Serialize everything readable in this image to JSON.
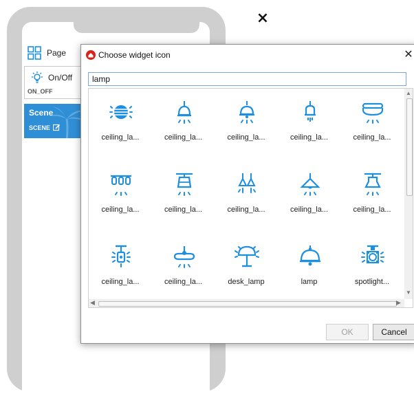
{
  "phone": {
    "close_glyph": "×",
    "page_item": {
      "label": "Page",
      "icon": "grid-icon"
    },
    "onoff_widget": {
      "label": "On/Off",
      "type": "ON_OFF",
      "icon": "bulb-icon"
    },
    "scene_widget": {
      "label": "Scene",
      "type": "SCENE",
      "icon": "edit-icon"
    }
  },
  "dialog": {
    "title": "Choose widget icon",
    "close_glyph": "✕",
    "search_value": "lamp",
    "icons": [
      {
        "label": "ceiling_la...",
        "icon": "ceiling-lamp-globe-icon"
      },
      {
        "label": "ceiling_la...",
        "icon": "ceiling-lamp-bell-icon"
      },
      {
        "label": "ceiling_la...",
        "icon": "ceiling-lamp-dome-icon"
      },
      {
        "label": "ceiling_la...",
        "icon": "ceiling-lamp-spot-icon"
      },
      {
        "label": "ceiling_la...",
        "icon": "ceiling-lamp-flush-icon"
      },
      {
        "label": "ceiling_la...",
        "icon": "ceiling-lamp-triple-icon"
      },
      {
        "label": "ceiling_la...",
        "icon": "ceiling-lamp-shade-icon"
      },
      {
        "label": "ceiling_la...",
        "icon": "ceiling-lamp-double-icon"
      },
      {
        "label": "ceiling_la...",
        "icon": "ceiling-lamp-pendant-icon"
      },
      {
        "label": "ceiling_la...",
        "icon": "ceiling-lamp-drum-icon"
      },
      {
        "label": "ceiling_la...",
        "icon": "ceiling-lamp-rod-icon"
      },
      {
        "label": "ceiling_la...",
        "icon": "ceiling-lamp-fan-icon"
      },
      {
        "label": "desk_lamp",
        "icon": "desk-lamp-icon"
      },
      {
        "label": "lamp",
        "icon": "lamp-icon"
      },
      {
        "label": "spotlight...",
        "icon": "spotlight-icon"
      }
    ],
    "ok_label": "OK",
    "cancel_label": "Cancel"
  },
  "colors": {
    "icon_blue": "#1e8fe0",
    "scene_blue": "#2f8fd6",
    "app_red": "#d9241c"
  }
}
